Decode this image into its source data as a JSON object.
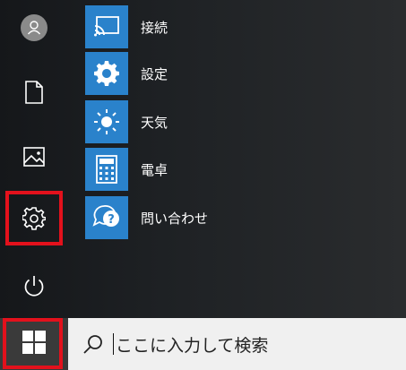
{
  "apps": [
    {
      "label": "接続",
      "icon": "connect-icon"
    },
    {
      "label": "設定",
      "icon": "settings-gear-icon"
    },
    {
      "label": "天気",
      "icon": "weather-sun-icon"
    },
    {
      "label": "電卓",
      "icon": "calculator-icon"
    },
    {
      "label": "問い合わせ",
      "icon": "help-chat-icon"
    }
  ],
  "rail": [
    {
      "name": "account",
      "icon": "user-avatar-icon"
    },
    {
      "name": "documents",
      "icon": "document-icon"
    },
    {
      "name": "pictures",
      "icon": "picture-icon"
    },
    {
      "name": "settings",
      "icon": "gear-icon",
      "highlighted": true
    },
    {
      "name": "power",
      "icon": "power-icon"
    }
  ],
  "taskbar": {
    "start_icon": "windows-logo-icon",
    "search_icon": "search-icon",
    "search_placeholder": "ここに入力して検索"
  },
  "colors": {
    "tile": "#2a82cb",
    "highlight": "#e3111c",
    "menu_bg": "#1e2124",
    "search_bg": "#f0f0f0"
  }
}
